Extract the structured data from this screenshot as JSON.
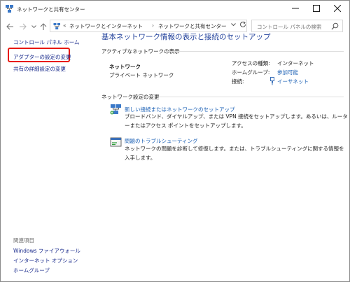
{
  "window": {
    "title": "ネットワークと共有センター"
  },
  "address": {
    "prefix": "«",
    "crumbs": [
      "ネットワークとインターネット",
      "ネットワークと共有センター"
    ],
    "separator": "›",
    "search_placeholder": "コントロール パネルの検索"
  },
  "sidebar": {
    "home": "コントロール パネル ホーム",
    "adapter": "アダプターの設定の変更",
    "sharing": "共有の詳細設定の変更",
    "see_also_title": "関連項目",
    "see_also": [
      "Windows ファイアウォール",
      "インターネット オプション",
      "ホームグループ"
    ]
  },
  "main": {
    "title": "基本ネットワーク情報の表示と接続のセットアップ",
    "active_heading": "アクティブなネットワークの表示",
    "network_name": "ネットワーク",
    "network_type": "プライベート ネットワーク",
    "props": {
      "access_label": "アクセスの種類:",
      "access_value": "インターネット",
      "homegroup_label": "ホームグループ:",
      "homegroup_value": "参加可能",
      "connection_label": "接続:",
      "connection_value": "イーサネット"
    },
    "change_heading": "ネットワーク設定の変更",
    "tasks": [
      {
        "link": "新しい接続またはネットワークのセットアップ",
        "desc": "ブロードバンド、ダイヤルアップ、または VPN 接続をセットアップします。あるいは、ルーターまたはアクセス ポイントをセットアップします。"
      },
      {
        "link": "問題のトラブルシューティング",
        "desc": "ネットワークの問題を診断して修復します。または、トラブルシューティングに関する情報を入手します。"
      }
    ]
  },
  "colors": {
    "link": "#1a5fb4",
    "title": "#1f3f9a",
    "highlight": "#e8180d"
  }
}
